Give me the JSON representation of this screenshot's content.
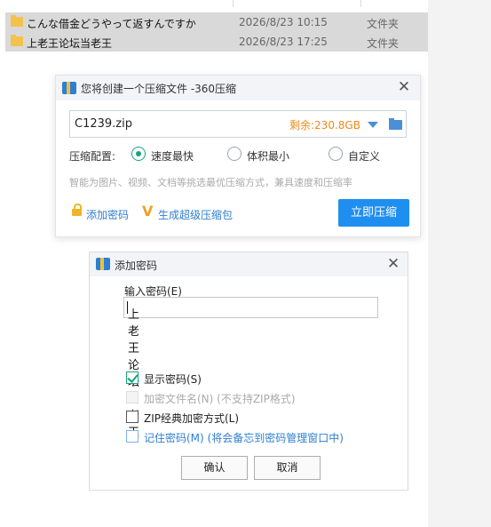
{
  "files": [
    {
      "name": "こんな借金どうやって返すんですか",
      "date": "2026/8/23 10:15",
      "type": "文件夹"
    },
    {
      "name": "上老王论坛当老王",
      "date": "2026/8/23 17:25",
      "type": "文件夹"
    }
  ],
  "compress_dialog": {
    "title": "您将创建一个压缩文件 -360压缩",
    "filename": "C1239.zip",
    "free_space": "剩余:230.8GB",
    "config_label": "压缩配置:",
    "options": [
      "速度最快",
      "体积最小",
      "自定义"
    ],
    "selected_option": "速度最快",
    "hint": "智能为图片、视频、文档等挑选最优压缩方式，兼具速度和压缩率",
    "add_password_link": "添加密码",
    "super_package_link": "生成超级压缩包",
    "compress_now_button": "立即压缩"
  },
  "password_dialog": {
    "title": "添加密码",
    "input_label": "输入密码(E)",
    "password_value": "上老王论坛当老王",
    "checkboxes": [
      {
        "label": "显示密码(S)",
        "checked": true,
        "disabled": false
      },
      {
        "label": "加密文件名(N) (不支持ZIP格式)",
        "checked": false,
        "disabled": true
      },
      {
        "label": "ZIP经典加密方式(L)",
        "checked": false,
        "disabled": false
      },
      {
        "label": "记住密码(M) (将会备忘到密码管理窗口中)",
        "checked": false,
        "disabled": false
      }
    ],
    "ok_button": "确认",
    "cancel_button": "取消"
  },
  "colors": {
    "accent": "#1e8ef0",
    "radio_selected": "#1aa37a",
    "free_space": "#ee8a1a",
    "link": "#2f7fd1"
  }
}
